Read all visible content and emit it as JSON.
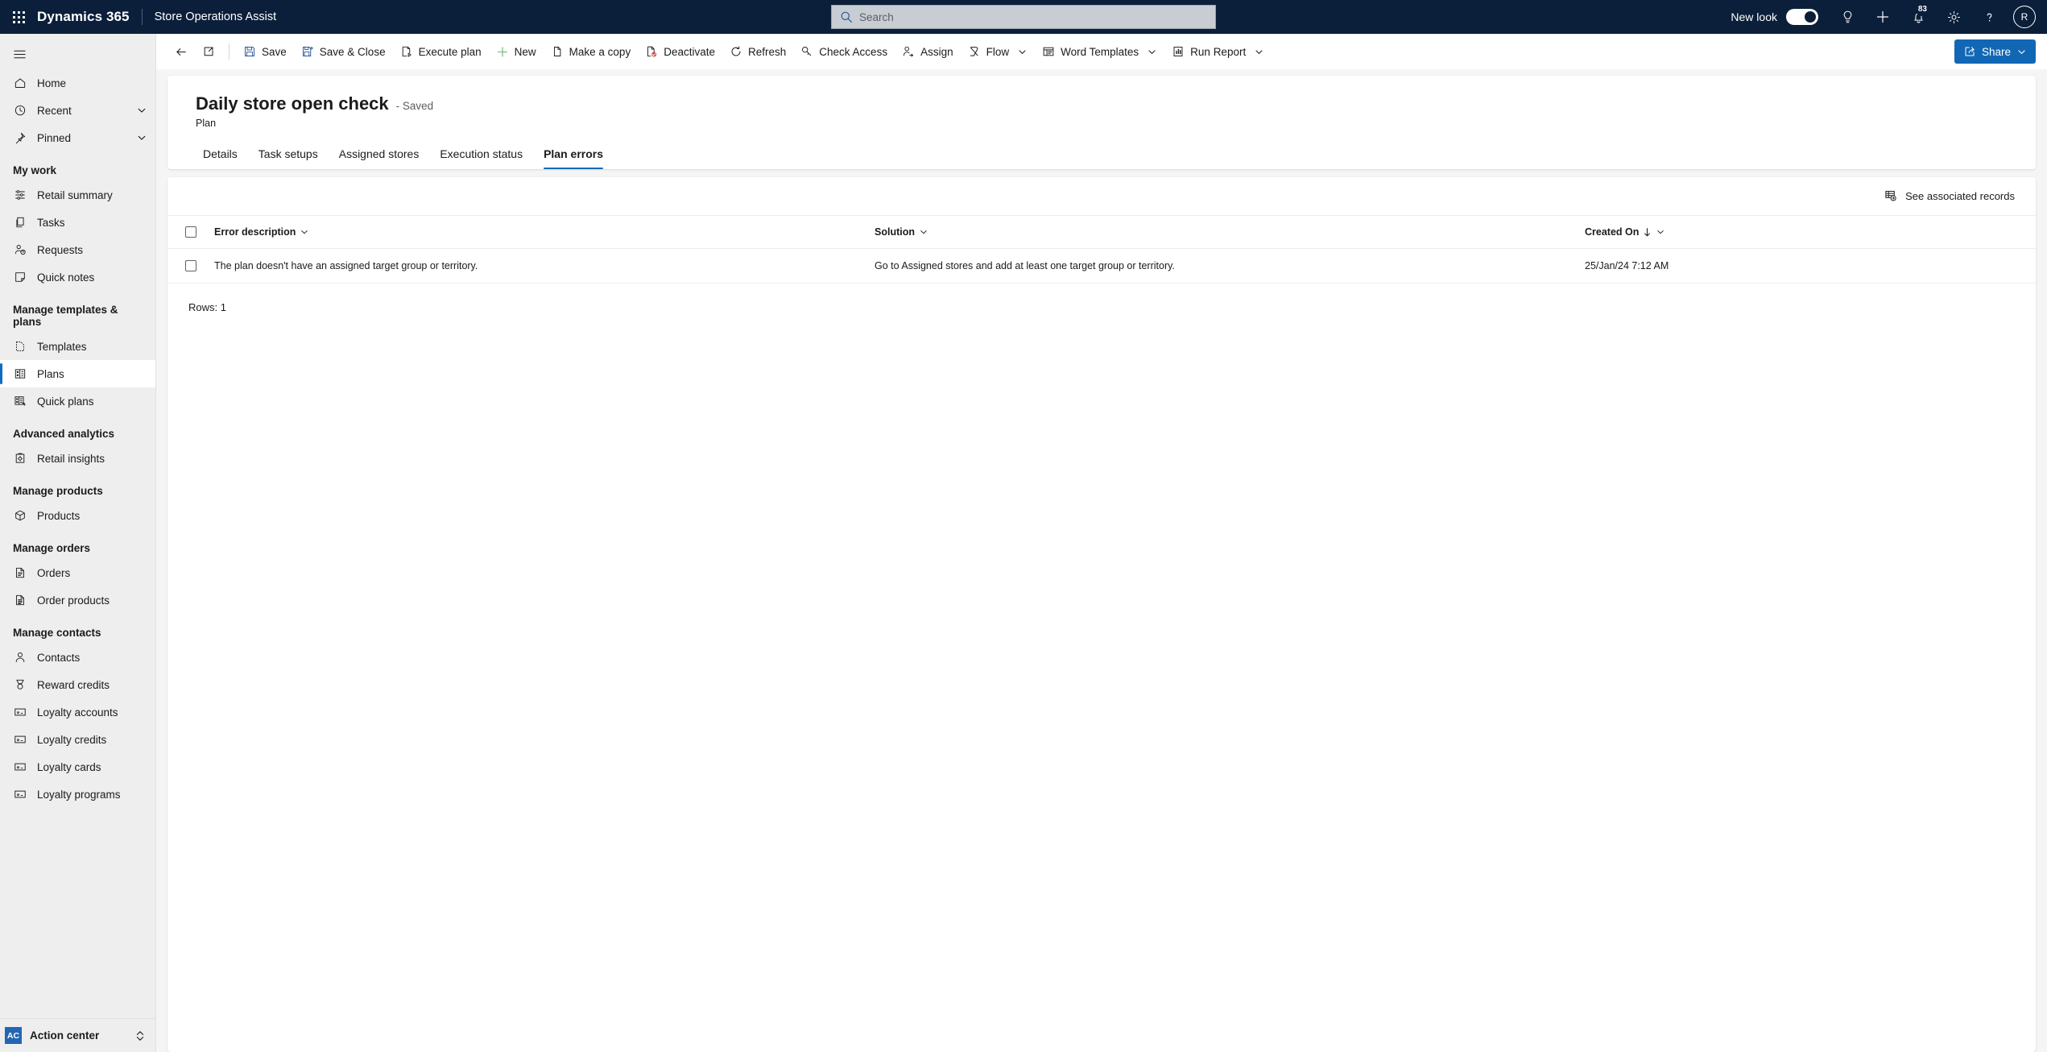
{
  "appbar": {
    "waffle_name": "app-launcher",
    "brand": "Dynamics 365",
    "app_name": "Store Operations Assist",
    "search": {
      "placeholder": "Search",
      "value": ""
    },
    "new_look_label": "New look",
    "new_look_on": true,
    "notification_count": "83",
    "avatar_initial": "R"
  },
  "sidebar": {
    "top_items": [
      {
        "label": "Home",
        "icon": "home-icon",
        "expandable": false
      },
      {
        "label": "Recent",
        "icon": "clock-icon",
        "expandable": true
      },
      {
        "label": "Pinned",
        "icon": "pin-icon",
        "expandable": true
      }
    ],
    "groups": [
      {
        "title": "My work",
        "items": [
          {
            "label": "Retail summary",
            "icon": "sliders-icon"
          },
          {
            "label": "Tasks",
            "icon": "copy-icon"
          },
          {
            "label": "Requests",
            "icon": "person-question-icon"
          },
          {
            "label": "Quick notes",
            "icon": "note-icon"
          }
        ]
      },
      {
        "title": "Manage templates & plans",
        "items": [
          {
            "label": "Templates",
            "icon": "template-icon"
          },
          {
            "label": "Plans",
            "icon": "plans-icon",
            "selected": true
          },
          {
            "label": "Quick plans",
            "icon": "quick-plans-icon"
          }
        ]
      },
      {
        "title": "Advanced analytics",
        "items": [
          {
            "label": "Retail insights",
            "icon": "insights-icon"
          }
        ]
      },
      {
        "title": "Manage products",
        "items": [
          {
            "label": "Products",
            "icon": "cube-icon"
          }
        ]
      },
      {
        "title": "Manage orders",
        "items": [
          {
            "label": "Orders",
            "icon": "order-icon"
          },
          {
            "label": "Order products",
            "icon": "order-products-icon"
          }
        ]
      },
      {
        "title": "Manage contacts",
        "items": [
          {
            "label": "Contacts",
            "icon": "person-icon"
          },
          {
            "label": "Reward credits",
            "icon": "medal-icon"
          },
          {
            "label": "Loyalty accounts",
            "icon": "card-icon"
          },
          {
            "label": "Loyalty credits",
            "icon": "card-icon"
          },
          {
            "label": "Loyalty cards",
            "icon": "card-icon"
          },
          {
            "label": "Loyalty programs",
            "icon": "card-icon"
          }
        ]
      }
    ],
    "footer": {
      "badge": "AC",
      "label": "Action center"
    }
  },
  "commandbar": {
    "back_name": "back-button",
    "popout_name": "popout-button",
    "items": [
      {
        "label": "Save",
        "icon": "save-icon",
        "chevron": false
      },
      {
        "label": "Save & Close",
        "icon": "save-close-icon",
        "chevron": false
      },
      {
        "label": "Execute plan",
        "icon": "execute-icon",
        "chevron": false
      },
      {
        "label": "New",
        "icon": "plus-icon",
        "chevron": false
      },
      {
        "label": "Make a copy",
        "icon": "copy-icon",
        "chevron": false
      },
      {
        "label": "Deactivate",
        "icon": "deactivate-icon",
        "chevron": false
      },
      {
        "label": "Refresh",
        "icon": "refresh-icon",
        "chevron": false
      },
      {
        "label": "Check Access",
        "icon": "key-icon",
        "chevron": false
      },
      {
        "label": "Assign",
        "icon": "assign-icon",
        "chevron": false
      },
      {
        "label": "Flow",
        "icon": "flow-icon",
        "chevron": true
      },
      {
        "label": "Word Templates",
        "icon": "word-template-icon",
        "chevron": true
      },
      {
        "label": "Run Report",
        "icon": "report-icon",
        "chevron": true
      }
    ],
    "share": {
      "label": "Share",
      "icon": "share-icon",
      "chevron": true,
      "color": "#1267b5"
    }
  },
  "record": {
    "title": "Daily store open check",
    "saved_status": "- Saved",
    "entity": "Plan",
    "tabs": [
      {
        "label": "Details",
        "active": false
      },
      {
        "label": "Task setups",
        "active": false
      },
      {
        "label": "Assigned stores",
        "active": false
      },
      {
        "label": "Execution status",
        "active": false
      },
      {
        "label": "Plan errors",
        "active": true
      }
    ]
  },
  "grid": {
    "associated_records_label": "See associated records",
    "columns": [
      {
        "label": "Error description",
        "sort": "none",
        "chevron": true
      },
      {
        "label": "Solution",
        "sort": "none",
        "chevron": true
      },
      {
        "label": "Created On",
        "sort": "desc",
        "chevron": true
      }
    ],
    "rows": [
      {
        "error_description": "The plan doesn't have an assigned target group or territory.",
        "solution": "Go to Assigned stores and add at least one target group or territory.",
        "created_on": "25/Jan/24 7:12 AM"
      }
    ],
    "row_count_label": "Rows: 1"
  },
  "colors": {
    "appbar_bg": "#0b1f3a",
    "accent": "#0f6cbd",
    "share_bg": "#1267b5",
    "sidebar_bg": "#eeeeee",
    "canvas_bg": "#f5f5f5"
  }
}
